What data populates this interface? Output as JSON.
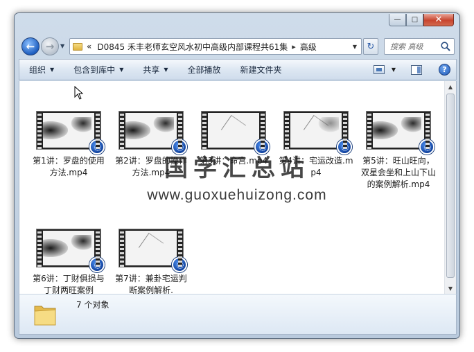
{
  "window": {
    "caption": {
      "minimize": "—",
      "maximize": "□",
      "close": "✕"
    }
  },
  "nav": {
    "back": "←",
    "forward": "→",
    "history": "▼"
  },
  "address": {
    "lead": "«",
    "crumbs": [
      "D0845 禾丰老师玄空风水初中高级内部课程共61集",
      "高级"
    ],
    "separator": "▸",
    "dropdown": "▼"
  },
  "refresh": "↻",
  "search": {
    "placeholder": "搜索 高级"
  },
  "toolbar": {
    "organize": "组织",
    "include_library": "包含到库中",
    "share": "共享",
    "play_all": "全部播放",
    "new_folder": "新建文件夹",
    "help": "?"
  },
  "files": [
    {
      "label": "第1讲：罗盘的使用方法.mp4"
    },
    {
      "label": "第2讲：罗盘的操作方法.mp4"
    },
    {
      "label": "第3讲：命宫.mp4"
    },
    {
      "label": "第4讲：宅运改造.mp4"
    },
    {
      "label": "第5讲：旺山旺向，双星会坐和上山下山的案例解析.mp4"
    },
    {
      "label": "第6讲：丁财俱损与丁财两旺案例"
    },
    {
      "label": "第7讲：兼卦宅运判断案例解析."
    }
  ],
  "watermark": {
    "chinese": "国学汇总站",
    "url": "www.guoxuehuizong.com"
  },
  "status": {
    "count": "7 个对象"
  },
  "colors": {
    "accent": "#1f58b8",
    "toolbar_text": "#1b2a3f"
  }
}
